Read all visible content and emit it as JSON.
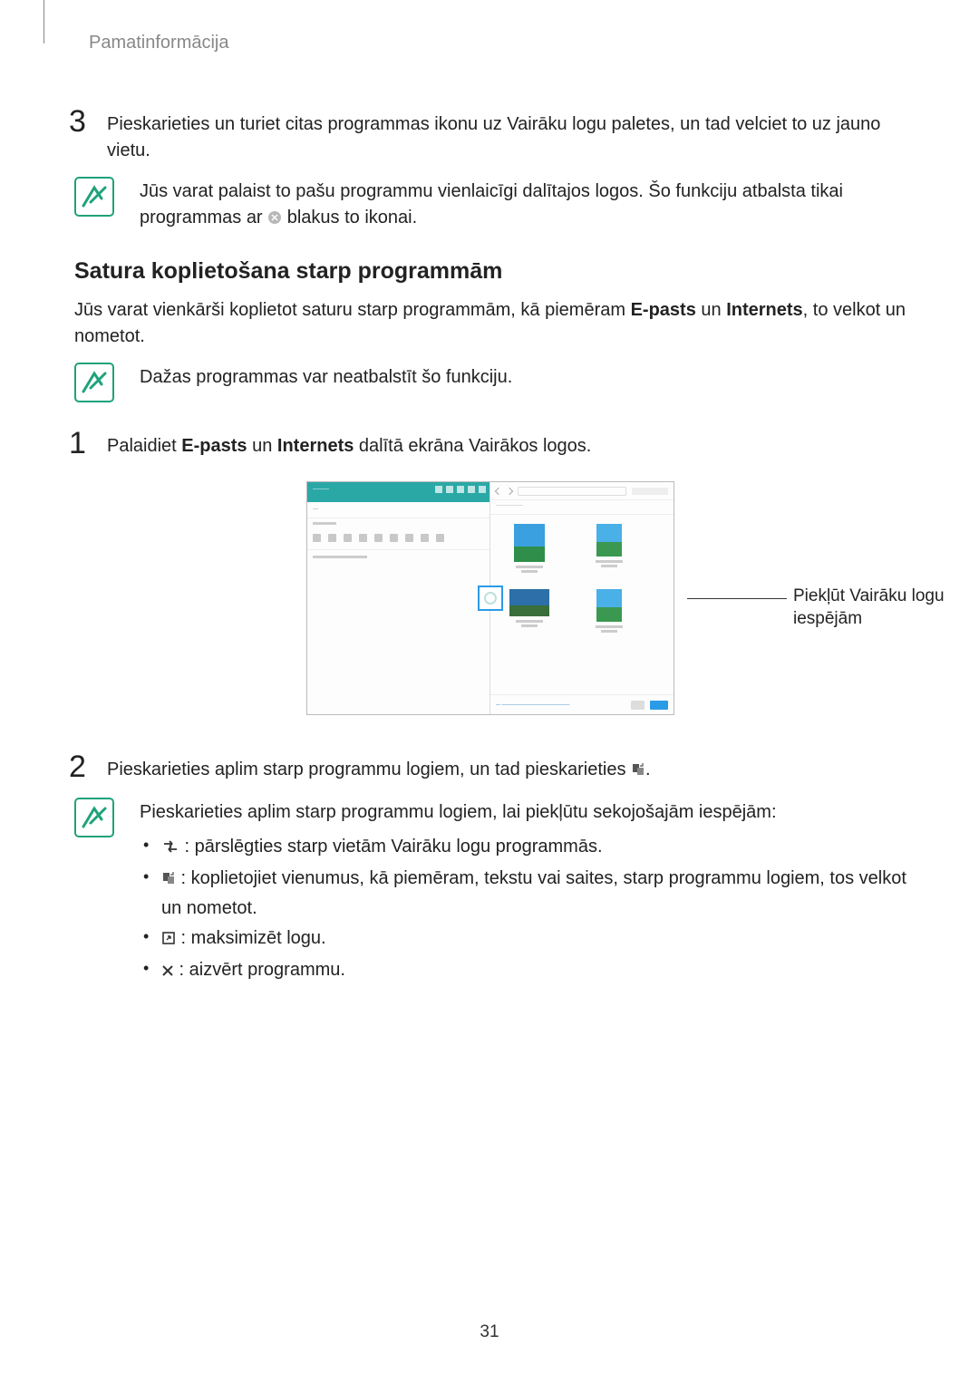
{
  "header": {
    "breadcrumb": "Pamatinformācija"
  },
  "step3": {
    "num": "3",
    "text": "Pieskarieties un turiet citas programmas ikonu uz Vairāku logu paletes, un tad velciet to uz jauno vietu."
  },
  "note1": {
    "text_a": "Jūs varat palaist to pašu programmu vienlaicīgi dalītajos logos. Šo funkciju atbalsta tikai programmas ar ",
    "text_b": " blakus to ikonai."
  },
  "section_title": "Satura koplietošana starp programmām",
  "intro": {
    "a": "Jūs varat vienkārši koplietot saturu starp programmām, kā piemēram ",
    "b": "E-pasts",
    "c": " un ",
    "d": "Internets",
    "e": ", to velkot un nometot."
  },
  "note2": {
    "text": "Dažas programmas var neatbalstīt šo funkciju."
  },
  "step1": {
    "num": "1",
    "a": "Palaidiet ",
    "b": "E-pasts",
    "c": " un ",
    "d": "Internets",
    "e": " dalītā ekrāna Vairākos logos."
  },
  "callout": {
    "text": "Piekļūt Vairāku logu iespējām"
  },
  "step2": {
    "num": "2",
    "a": "Pieskarieties aplim starp programmu logiem, un tad pieskarieties ",
    "b": "."
  },
  "note3": {
    "lead": "Pieskarieties aplim starp programmu logiem, lai piekļūtu sekojošajām iespējām:",
    "items": [
      {
        "icon": "swap",
        "text": " : pārslēgties starp vietām Vairāku logu programmās."
      },
      {
        "icon": "drag",
        "text": " : koplietojiet vienumus, kā piemēram, tekstu vai saites, starp programmu logiem, tos velkot un nometot."
      },
      {
        "icon": "maximize",
        "text": " : maksimizēt logu."
      },
      {
        "icon": "close",
        "text": " : aizvērt programmu."
      }
    ]
  },
  "page_number": "31"
}
